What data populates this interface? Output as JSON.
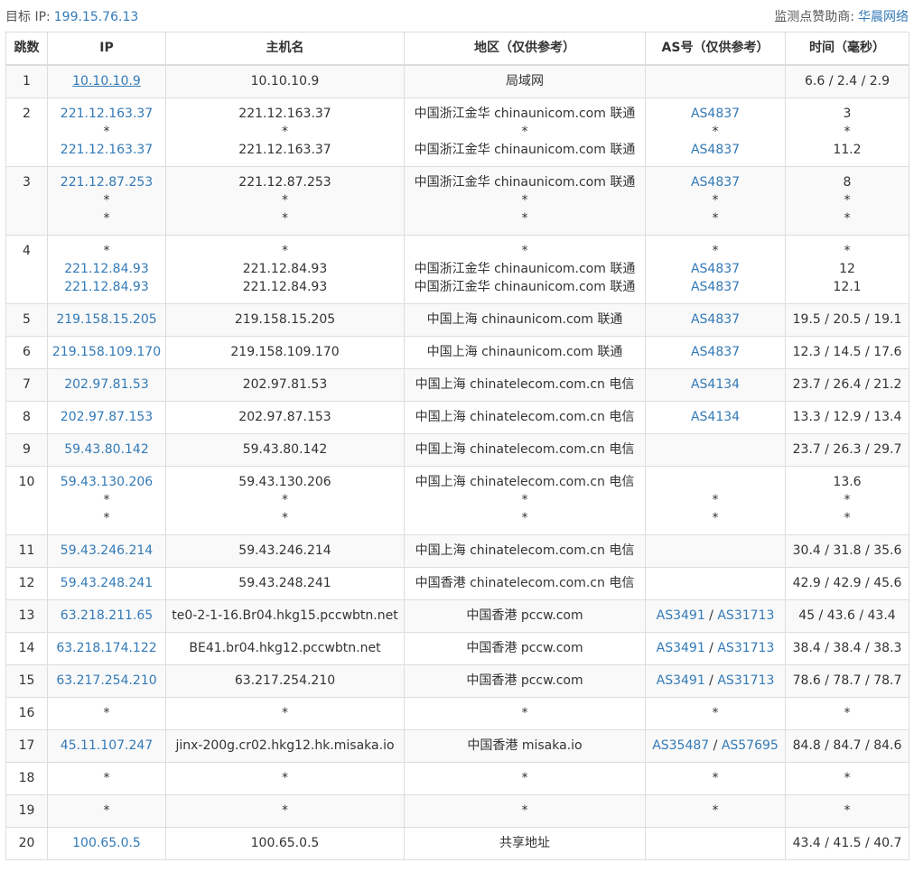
{
  "header": {
    "target_label": "目标 IP:",
    "target_ip": "199.15.76.13",
    "sponsor_label": "监测点赞助商:",
    "sponsor_name": "华晨网络"
  },
  "table": {
    "columns": [
      "跳数",
      "IP",
      "主机名",
      "地区（仅供参考）",
      "AS号（仅供参考）",
      "时间（毫秒）"
    ],
    "rows": [
      {
        "hop": "1",
        "lines": [
          {
            "ip": "10.10.10.9",
            "host": "10.10.10.9",
            "region": "局域网",
            "asn": [],
            "time": "6.6 / 2.4 / 2.9"
          }
        ]
      },
      {
        "hop": "2",
        "lines": [
          {
            "ip": "221.12.163.37",
            "host": "221.12.163.37",
            "region": "中国浙江金华 chinaunicom.com 联通",
            "asn": [
              "AS4837"
            ],
            "time": "3"
          },
          {
            "ip": "*",
            "host": "*",
            "region": "*",
            "asn": [
              "*"
            ],
            "time": "*"
          },
          {
            "ip": "221.12.163.37",
            "host": "221.12.163.37",
            "region": "中国浙江金华 chinaunicom.com 联通",
            "asn": [
              "AS4837"
            ],
            "time": "11.2"
          }
        ]
      },
      {
        "hop": "3",
        "lines": [
          {
            "ip": "221.12.87.253",
            "host": "221.12.87.253",
            "region": "中国浙江金华 chinaunicom.com 联通",
            "asn": [
              "AS4837"
            ],
            "time": "8"
          },
          {
            "ip": "*",
            "host": "*",
            "region": "*",
            "asn": [
              "*"
            ],
            "time": "*"
          },
          {
            "ip": "*",
            "host": "*",
            "region": "*",
            "asn": [
              "*"
            ],
            "time": "*"
          }
        ]
      },
      {
        "hop": "4",
        "lines": [
          {
            "ip": "*",
            "host": "*",
            "region": "*",
            "asn": [
              "*"
            ],
            "time": "*"
          },
          {
            "ip": "221.12.84.93",
            "host": "221.12.84.93",
            "region": "中国浙江金华 chinaunicom.com 联通",
            "asn": [
              "AS4837"
            ],
            "time": "12"
          },
          {
            "ip": "221.12.84.93",
            "host": "221.12.84.93",
            "region": "中国浙江金华 chinaunicom.com 联通",
            "asn": [
              "AS4837"
            ],
            "time": "12.1"
          }
        ]
      },
      {
        "hop": "5",
        "lines": [
          {
            "ip": "219.158.15.205",
            "host": "219.158.15.205",
            "region": "中国上海 chinaunicom.com 联通",
            "asn": [
              "AS4837"
            ],
            "time": "19.5 / 20.5 / 19.1"
          }
        ]
      },
      {
        "hop": "6",
        "lines": [
          {
            "ip": "219.158.109.170",
            "host": "219.158.109.170",
            "region": "中国上海 chinaunicom.com 联通",
            "asn": [
              "AS4837"
            ],
            "time": "12.3 / 14.5 / 17.6"
          }
        ]
      },
      {
        "hop": "7",
        "lines": [
          {
            "ip": "202.97.81.53",
            "host": "202.97.81.53",
            "region": "中国上海 chinatelecom.com.cn 电信",
            "asn": [
              "AS4134"
            ],
            "time": "23.7 / 26.4 / 21.2"
          }
        ]
      },
      {
        "hop": "8",
        "lines": [
          {
            "ip": "202.97.87.153",
            "host": "202.97.87.153",
            "region": "中国上海 chinatelecom.com.cn 电信",
            "asn": [
              "AS4134"
            ],
            "time": "13.3 / 12.9 / 13.4"
          }
        ]
      },
      {
        "hop": "9",
        "lines": [
          {
            "ip": "59.43.80.142",
            "host": "59.43.80.142",
            "region": "中国上海 chinatelecom.com.cn 电信",
            "asn": [],
            "time": "23.7 / 26.3 / 29.7"
          }
        ]
      },
      {
        "hop": "10",
        "lines": [
          {
            "ip": "59.43.130.206",
            "host": "59.43.130.206",
            "region": "中国上海 chinatelecom.com.cn 电信",
            "asn": [],
            "time": "13.6"
          },
          {
            "ip": "*",
            "host": "*",
            "region": "*",
            "asn": [
              "*"
            ],
            "time": "*"
          },
          {
            "ip": "*",
            "host": "*",
            "region": "*",
            "asn": [
              "*"
            ],
            "time": "*"
          }
        ]
      },
      {
        "hop": "11",
        "lines": [
          {
            "ip": "59.43.246.214",
            "host": "59.43.246.214",
            "region": "中国上海 chinatelecom.com.cn 电信",
            "asn": [],
            "time": "30.4 / 31.8 / 35.6"
          }
        ]
      },
      {
        "hop": "12",
        "lines": [
          {
            "ip": "59.43.248.241",
            "host": "59.43.248.241",
            "region": "中国香港 chinatelecom.com.cn 电信",
            "asn": [],
            "time": "42.9 / 42.9 / 45.6"
          }
        ]
      },
      {
        "hop": "13",
        "lines": [
          {
            "ip": "63.218.211.65",
            "host": "te0-2-1-16.Br04.hkg15.pccwbtn.net",
            "region": "中国香港 pccw.com",
            "asn": [
              "AS3491",
              "AS31713"
            ],
            "time": "45 / 43.6 / 43.4"
          }
        ]
      },
      {
        "hop": "14",
        "lines": [
          {
            "ip": "63.218.174.122",
            "host": "BE41.br04.hkg12.pccwbtn.net",
            "region": "中国香港 pccw.com",
            "asn": [
              "AS3491",
              "AS31713"
            ],
            "time": "38.4 / 38.4 / 38.3"
          }
        ]
      },
      {
        "hop": "15",
        "lines": [
          {
            "ip": "63.217.254.210",
            "host": "63.217.254.210",
            "region": "中国香港 pccw.com",
            "asn": [
              "AS3491",
              "AS31713"
            ],
            "time": "78.6 / 78.7 / 78.7"
          }
        ]
      },
      {
        "hop": "16",
        "lines": [
          {
            "ip": "*",
            "host": "*",
            "region": "*",
            "asn": [
              "*"
            ],
            "time": "*"
          }
        ]
      },
      {
        "hop": "17",
        "lines": [
          {
            "ip": "45.11.107.247",
            "host": "jinx-200g.cr02.hkg12.hk.misaka.io",
            "region": "中国香港 misaka.io",
            "asn": [
              "AS35487",
              "AS57695"
            ],
            "time": "84.8 / 84.7 / 84.6"
          }
        ]
      },
      {
        "hop": "18",
        "lines": [
          {
            "ip": "*",
            "host": "*",
            "region": "*",
            "asn": [
              "*"
            ],
            "time": "*"
          }
        ]
      },
      {
        "hop": "19",
        "lines": [
          {
            "ip": "*",
            "host": "*",
            "region": "*",
            "asn": [
              "*"
            ],
            "time": "*"
          }
        ]
      },
      {
        "hop": "20",
        "lines": [
          {
            "ip": "100.65.0.5",
            "host": "100.65.0.5",
            "region": "共享地址",
            "asn": [],
            "time": "43.4 / 41.5 / 40.7"
          }
        ]
      }
    ]
  }
}
